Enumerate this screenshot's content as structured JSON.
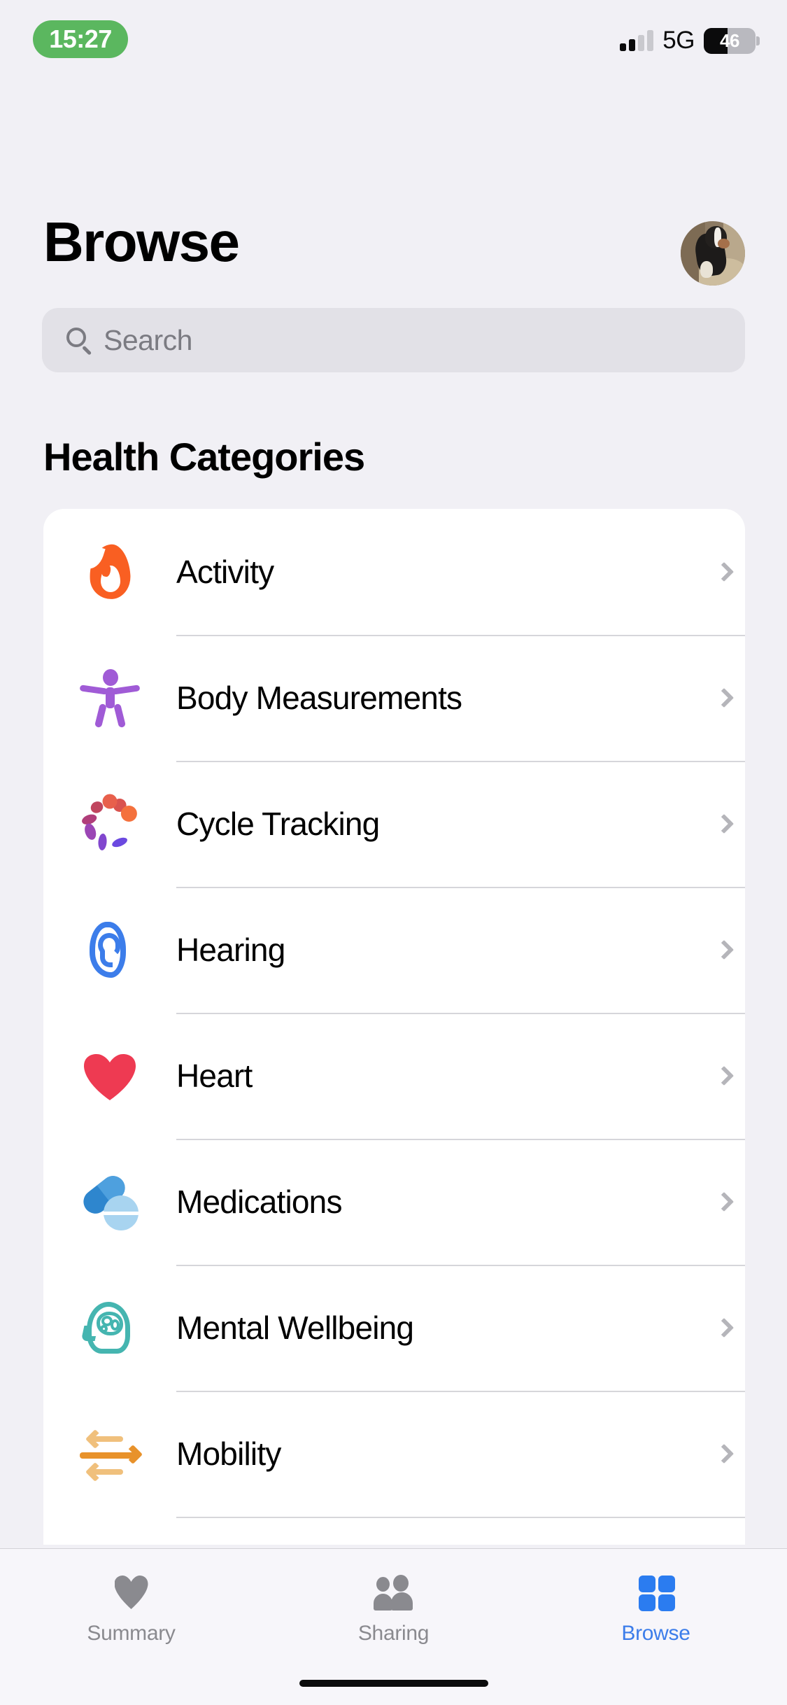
{
  "status_bar": {
    "time": "15:27",
    "network": "5G",
    "battery_percent": "46",
    "battery_level": 46,
    "signal_bars_filled": 2,
    "signal_bars_total": 4
  },
  "header": {
    "title": "Browse",
    "avatar_name": "profile-avatar"
  },
  "search": {
    "placeholder": "Search",
    "value": "",
    "icon": "search-icon"
  },
  "section": {
    "title": "Health Categories"
  },
  "categories": [
    {
      "label": "Activity",
      "icon": "flame-icon",
      "color": "#F95F22"
    },
    {
      "label": "Body Measurements",
      "icon": "body-figure-icon",
      "color": "#A05BD6"
    },
    {
      "label": "Cycle Tracking",
      "icon": "cycle-dots-icon",
      "color": "#E8604C"
    },
    {
      "label": "Hearing",
      "icon": "ear-icon",
      "color": "#3C7DEA"
    },
    {
      "label": "Heart",
      "icon": "heart-icon",
      "color": "#EE3A52"
    },
    {
      "label": "Medications",
      "icon": "pills-icon",
      "color": "#2E86CE"
    },
    {
      "label": "Mental Wellbeing",
      "icon": "brain-head-icon",
      "color": "#45B5B0"
    },
    {
      "label": "Mobility",
      "icon": "arrows-icon",
      "color": "#E8922B"
    }
  ],
  "tabs": [
    {
      "label": "Summary",
      "icon": "heart-icon",
      "active": false
    },
    {
      "label": "Sharing",
      "icon": "people-icon",
      "active": false
    },
    {
      "label": "Browse",
      "icon": "grid-icon",
      "active": true
    }
  ],
  "colors": {
    "background": "#F1F0F5",
    "card": "#FFFFFF",
    "accent": "#2B7CF0",
    "inactive_tab": "#8A8A8F",
    "separator": "#D6D6DA",
    "search_field": "#E2E1E7",
    "time_pill": "#5BB75F"
  }
}
